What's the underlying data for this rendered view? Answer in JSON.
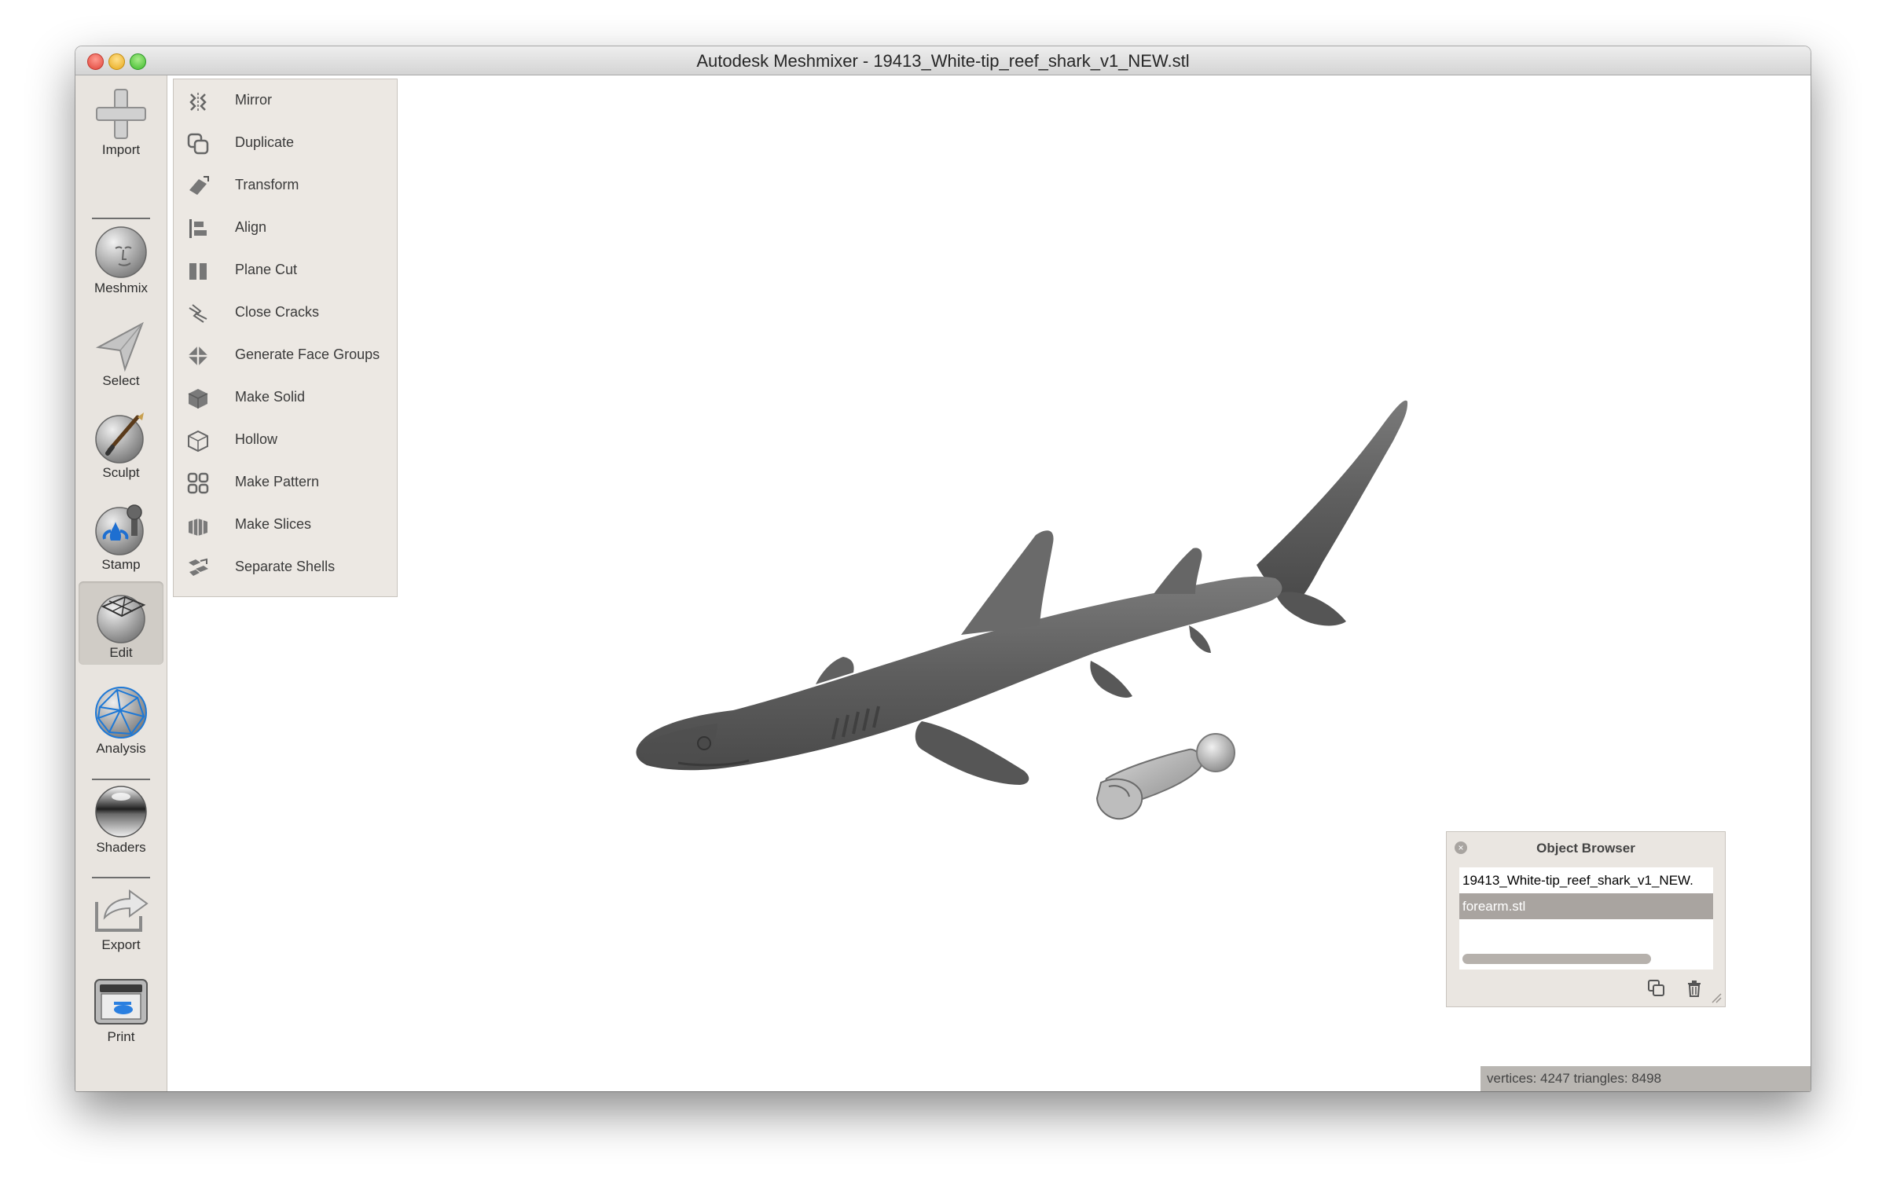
{
  "window": {
    "title": "Autodesk Meshmixer - 19413_White-tip_reef_shark_v1_NEW.stl"
  },
  "toolbar": {
    "items": [
      {
        "label": "Import",
        "icon": "plus-icon"
      },
      {
        "label": "Meshmix",
        "icon": "face-sphere-icon"
      },
      {
        "label": "Select",
        "icon": "arrow-pointer-icon"
      },
      {
        "label": "Sculpt",
        "icon": "brush-sphere-icon"
      },
      {
        "label": "Stamp",
        "icon": "stamp-sphere-icon"
      },
      {
        "label": "Edit",
        "icon": "edit-sphere-icon",
        "active": true
      },
      {
        "label": "Analysis",
        "icon": "mesh-sphere-icon"
      },
      {
        "label": "Shaders",
        "icon": "chrome-sphere-icon"
      },
      {
        "label": "Export",
        "icon": "export-tray-icon"
      },
      {
        "label": "Print",
        "icon": "printer-icon"
      }
    ]
  },
  "edit_menu": {
    "items": [
      {
        "label": "Mirror",
        "icon": "mirror-icon"
      },
      {
        "label": "Duplicate",
        "icon": "duplicate-icon"
      },
      {
        "label": "Transform",
        "icon": "transform-icon"
      },
      {
        "label": "Align",
        "icon": "align-icon"
      },
      {
        "label": "Plane Cut",
        "icon": "plane-cut-icon"
      },
      {
        "label": "Close Cracks",
        "icon": "close-cracks-icon"
      },
      {
        "label": "Generate Face Groups",
        "icon": "face-groups-icon"
      },
      {
        "label": "Make Solid",
        "icon": "solid-cube-icon"
      },
      {
        "label": "Hollow",
        "icon": "hollow-cube-icon"
      },
      {
        "label": "Make Pattern",
        "icon": "pattern-icon"
      },
      {
        "label": "Make Slices",
        "icon": "slices-icon"
      },
      {
        "label": "Separate Shells",
        "icon": "shells-icon"
      }
    ]
  },
  "object_browser": {
    "title": "Object Browser",
    "objects": [
      {
        "name": "19413_White-tip_reef_shark_v1_NEW.",
        "selected": false
      },
      {
        "name": "forearm.stl",
        "selected": true
      }
    ],
    "buttons": [
      "duplicate-icon",
      "trash-icon"
    ]
  },
  "status": {
    "text": "vertices: 4247 triangles: 8498"
  },
  "colors": {
    "toolbar_bg": "#e8e4df",
    "selection": "#a9a4a0",
    "mesh_gray": "#5e5e5e",
    "status_bg": "#b9b6b2"
  }
}
